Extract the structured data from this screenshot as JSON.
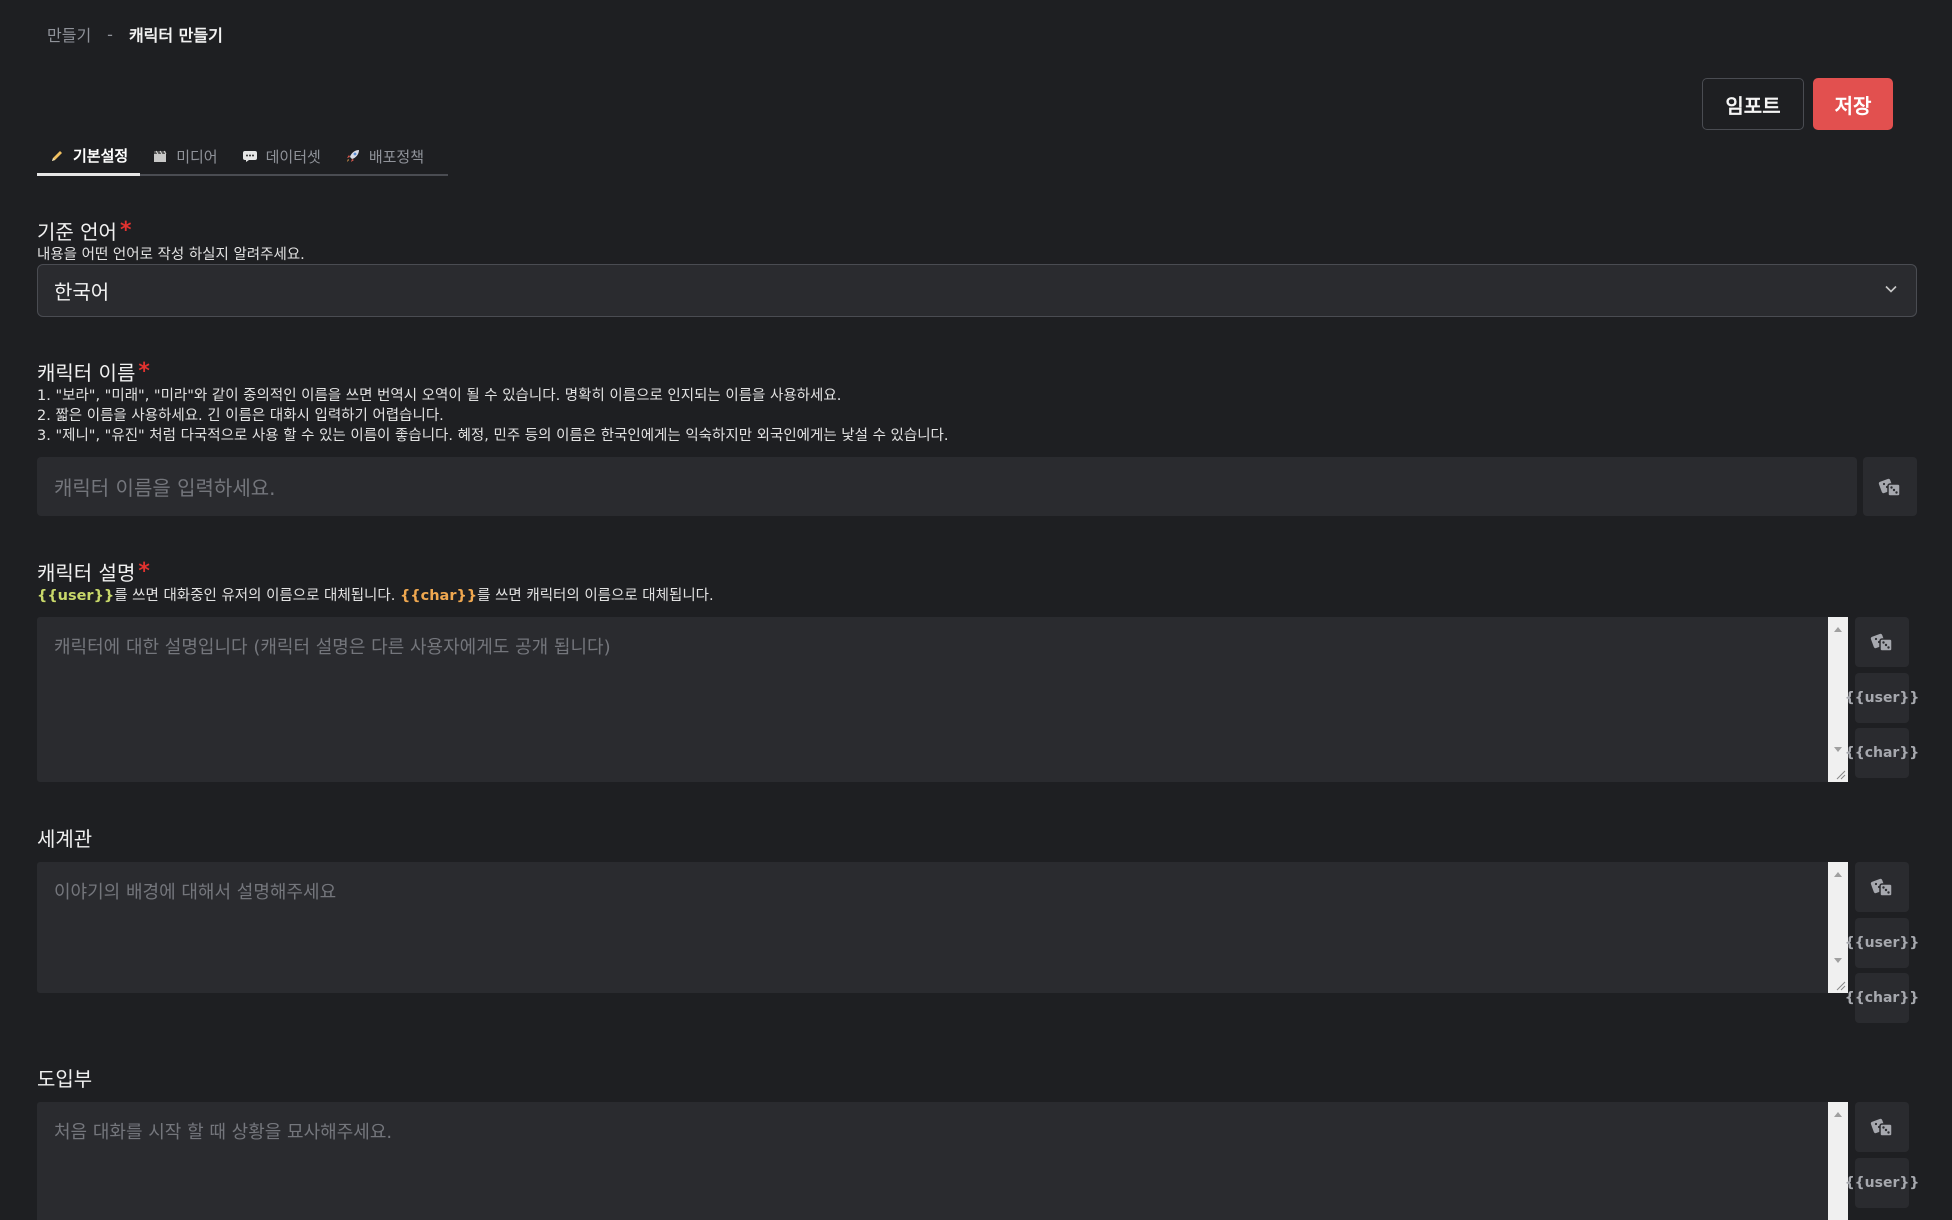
{
  "breadcrumb": {
    "parent": "만들기",
    "separator": "-",
    "current": "캐릭터 만들기"
  },
  "actions": {
    "import_label": "임포트",
    "save_label": "저장"
  },
  "colors": {
    "accent": "#e2504f",
    "background": "#1e1f22",
    "field": "#2a2b2f",
    "required": "#e2322f",
    "user_token": "#c8d86a",
    "char_token": "#f0a850"
  },
  "tabs": [
    {
      "label": "기본설정",
      "icon": "pencil-icon",
      "active": true
    },
    {
      "label": "미디어",
      "icon": "clapperboard-icon",
      "active": false
    },
    {
      "label": "데이터셋",
      "icon": "chat-bubble-icon",
      "active": false
    },
    {
      "label": "배포정책",
      "icon": "rocket-icon",
      "active": false
    }
  ],
  "language": {
    "label": "기준 언어",
    "required_mark": "*",
    "hint": "내용을 어떤 언어로 작성 하실지 알려주세요.",
    "selected": "한국어"
  },
  "name": {
    "label": "캐릭터 이름",
    "required_mark": "*",
    "hints": [
      "1. \"보라\", \"미래\", \"미라\"와 같이 중의적인 이름을 쓰면 번역시 오역이 될 수 있습니다. 명확히 이름으로 인지되는 이름을 사용하세요.",
      "2. 짧은 이름을 사용하세요. 긴 이름은 대화시 입력하기 어렵습니다.",
      "3. \"제니\", \"유진\" 처럼 다국적으로 사용 할 수 있는 이름이 좋습니다. 혜정, 민주 등의 이름은 한국인에게는 익숙하지만 외국인에게는 낯설 수 있습니다."
    ],
    "placeholder": "캐릭터 이름을 입력하세요."
  },
  "description": {
    "label": "캐릭터 설명",
    "required_mark": "*",
    "hint_user_token": "{{user}}",
    "hint_part1": "를 쓰면 대화중인 유저의 이름으로 대체됩니다. ",
    "hint_char_token": "{{char}}",
    "hint_part2": "를 쓰면 캐릭터의 이름으로 대체됩니다.",
    "placeholder": "캐릭터에 대한 설명입니다 (캐릭터 설명은 다른 사용자에게도 공개 됩니다)"
  },
  "world": {
    "label": "세계관",
    "placeholder": "이야기의 배경에 대해서 설명해주세요"
  },
  "intro": {
    "label": "도입부",
    "placeholder": "처음 대화를 시작 할 때 상황을 묘사해주세요."
  },
  "side_buttons": {
    "user_label": "{{user}}",
    "char_label": "{{char}}"
  }
}
